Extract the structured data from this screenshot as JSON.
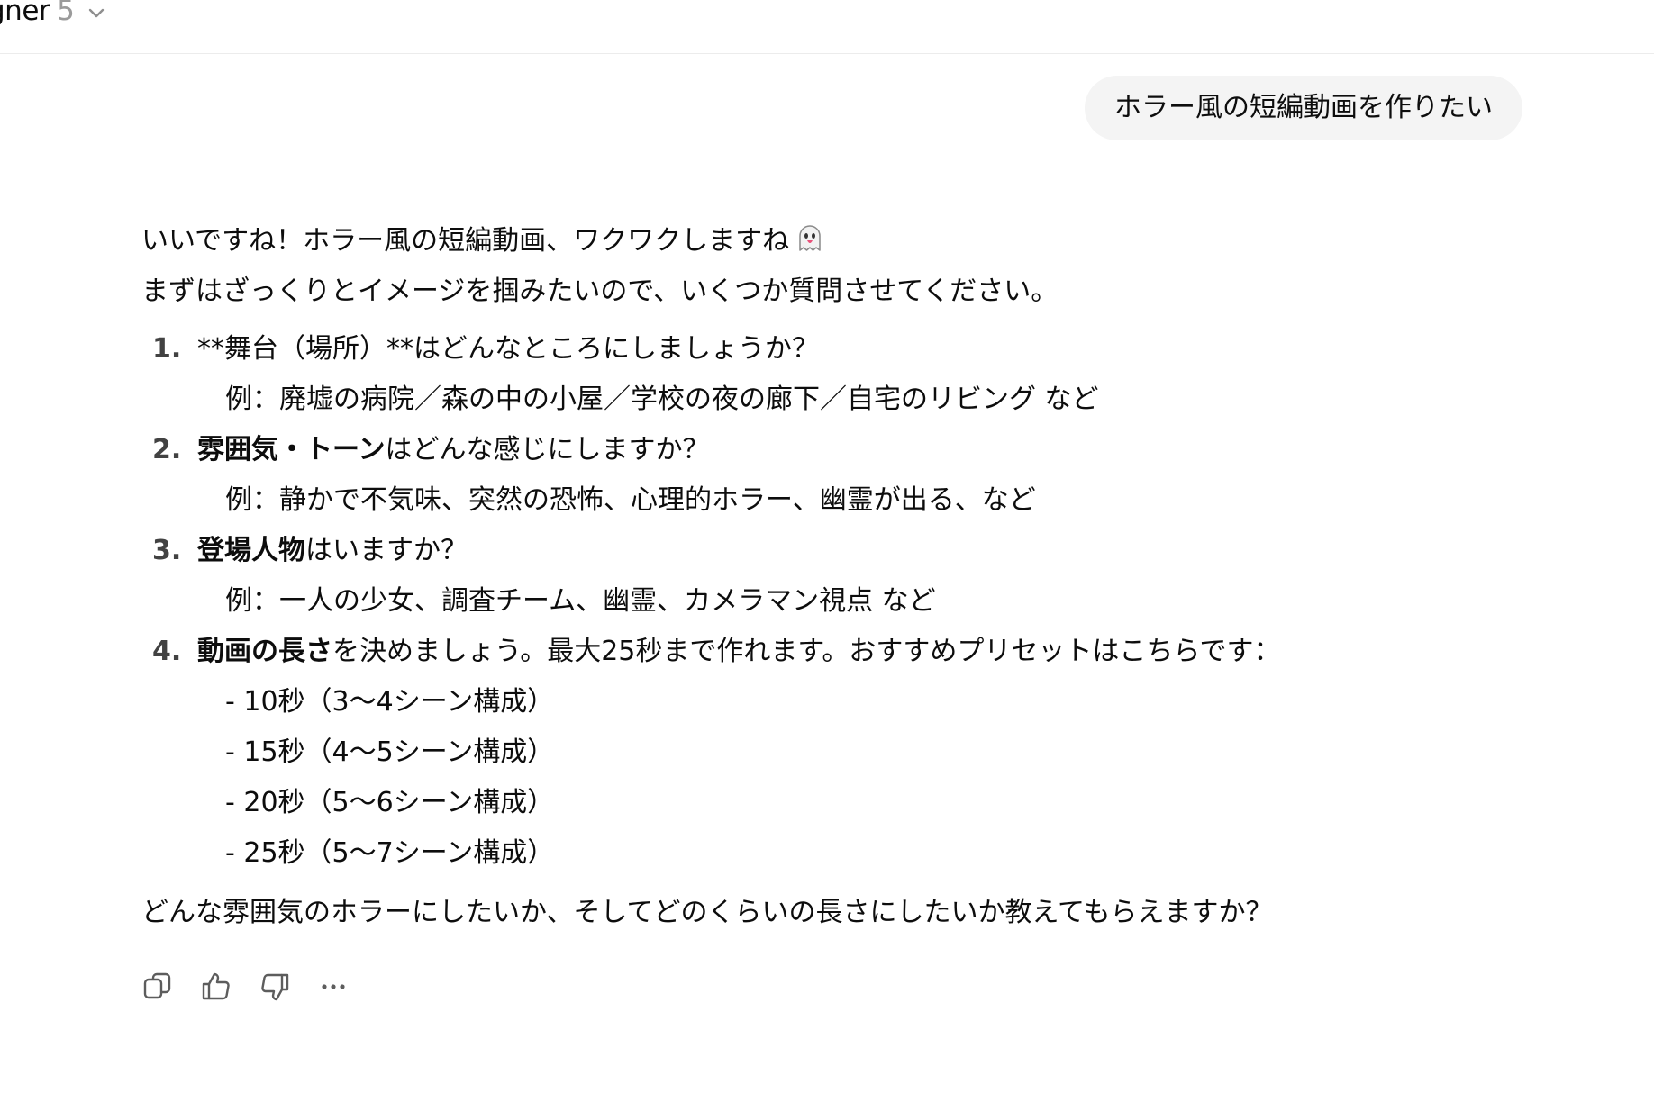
{
  "header": {
    "model_name": "gner",
    "model_version": "5"
  },
  "user_message": "ホラー風の短編動画を作りたい",
  "assistant": {
    "intro_line1": "いいですね！ホラー風の短編動画、ワクワクしますね",
    "intro_line2": "まずはざっくりとイメージを掴みたいので、いくつか質問させてください。",
    "items": [
      {
        "num": "1.",
        "bold": "",
        "text": "**舞台（場所）**はどんなところにしましょうか？",
        "sub": [
          "例：廃墟の病院／森の中の小屋／学校の夜の廊下／自宅のリビング など"
        ]
      },
      {
        "num": "2.",
        "bold": "雰囲気・トーン",
        "text": "はどんな感じにしますか？",
        "sub": [
          "例：静かで不気味、突然の恐怖、心理的ホラー、幽霊が出る、など"
        ]
      },
      {
        "num": "3.",
        "bold": "登場人物",
        "text": "はいますか？",
        "sub": [
          "例：一人の少女、調査チーム、幽霊、カメラマン視点 など"
        ]
      },
      {
        "num": "4.",
        "bold": "動画の長さ",
        "text": "を決めましょう。最大25秒まで作れます。おすすめプリセットはこちらです：",
        "sub": [
          "- 10秒（3〜4シーン構成）",
          "- 15秒（4〜5シーン構成）",
          "- 20秒（5〜6シーン構成）",
          "- 25秒（5〜7シーン構成）"
        ]
      }
    ],
    "closing": "どんな雰囲気のホラーにしたいか、そしてどのくらいの長さにしたいか教えてもらえますか？"
  },
  "actions": {
    "copy_icon": "copy-icon",
    "thumbs_up_icon": "thumbs-up-icon",
    "thumbs_down_icon": "thumbs-down-icon",
    "more_icon": "more-icon"
  }
}
